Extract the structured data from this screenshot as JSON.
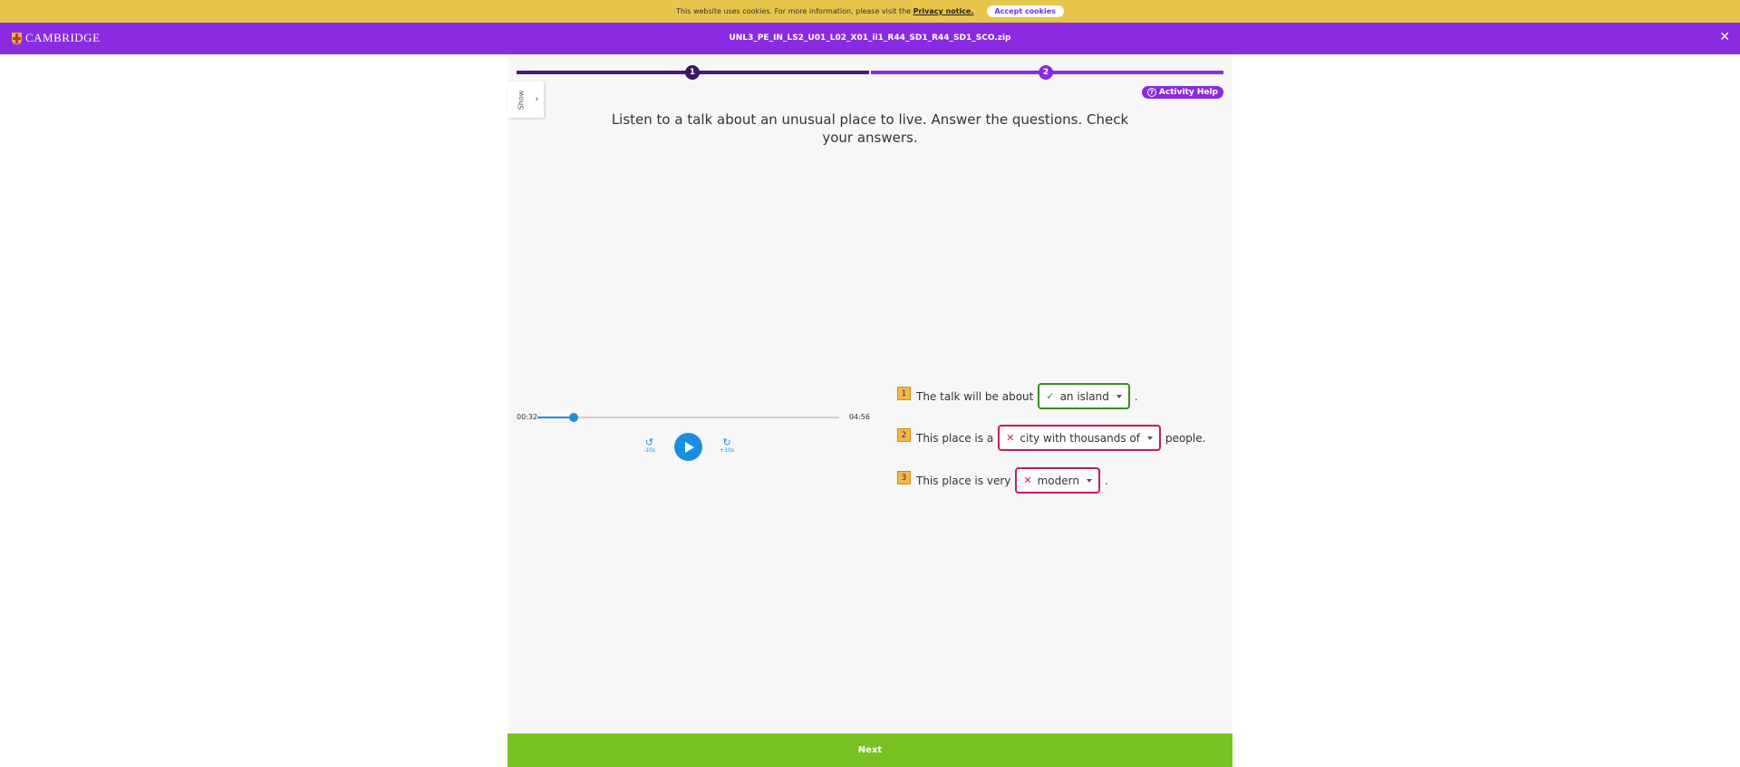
{
  "cookie_banner": {
    "text": "This website uses cookies. For more information, please visit the",
    "privacy_link": "Privacy notice.",
    "accept_label": "Accept cookies"
  },
  "header": {
    "logo_text": "CAMBRIDGE",
    "file_title": "UNL3_PE_IN_LS2_U01_L02_X01_ii1_R44_SD1_R44_SD1_SCO.zip",
    "close_symbol": "✕"
  },
  "colors": {
    "brand_purple": "#8a2be2",
    "cookie_yellow": "#e6c54a",
    "correct_green": "#3b8c1e",
    "wrong_red": "#d11b4a",
    "audio_blue": "#1a8fe0",
    "next_green": "#78c223"
  },
  "progress": {
    "steps": [
      {
        "label": "1"
      },
      {
        "label": "2"
      }
    ],
    "current_step": 1
  },
  "sidebar_toggle": {
    "label": "Show",
    "icon": "chevron-right-icon",
    "chevron": "›"
  },
  "help_button": {
    "label": "Activity Help",
    "icon": "question-circle-icon",
    "glyph": "?"
  },
  "instructions": "Listen to a talk about an unusual place to live. Answer the questions. Check your answers.",
  "audio": {
    "current_time": "00:32",
    "duration": "04:56",
    "progress_fraction": 0.12,
    "rewind_label": "-10s",
    "forward_label": "+10s",
    "rewind_glyph": "↺",
    "forward_glyph": "↻"
  },
  "questions": [
    {
      "number": "1",
      "before": "The talk will be about",
      "answer": "an island",
      "status": "correct",
      "after": "."
    },
    {
      "number": "2",
      "before": "This place is a",
      "answer": "city with thousands of",
      "status": "wrong",
      "after": "people."
    },
    {
      "number": "3",
      "before": "This place is very",
      "answer": "modern",
      "status": "wrong",
      "after": "."
    }
  ],
  "marks": {
    "correct": "✓",
    "wrong": "✕"
  },
  "next_label": "Next"
}
